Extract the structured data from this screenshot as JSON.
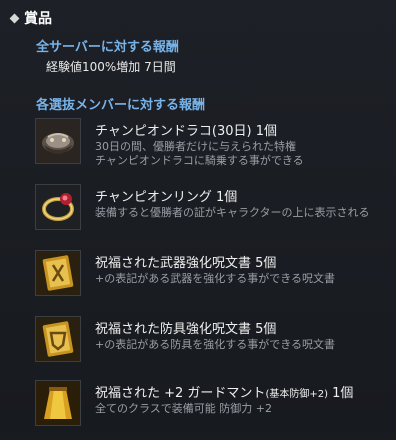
{
  "header": {
    "title": "賞品"
  },
  "all_servers": {
    "heading": "全サーバーに対する報酬",
    "reward": "経験値100%増加 7日間"
  },
  "selected_members": {
    "heading": "各選抜メンバーに対する報酬",
    "items": [
      {
        "name": "チャンピオンドラコ(30日)",
        "qty": "1個",
        "desc1": "30日の間、優勝者だけに与えられた特権",
        "desc2": "チャンピオンドラコに騎乗する事ができる",
        "icon": "dragon-saddle-icon"
      },
      {
        "name": "チャンピオンリング",
        "qty": "1個",
        "desc1": "装備すると優勝者の証がキャラクターの上に表示される",
        "desc2": "",
        "icon": "ring-icon"
      },
      {
        "name": "祝福された武器強化呪文書",
        "qty": "5個",
        "desc1": "+の表記がある武器を強化する事ができる呪文書",
        "desc2": "",
        "icon": "weapon-scroll-icon"
      },
      {
        "name": "祝福された防具強化呪文書",
        "qty": "5個",
        "desc1": "+の表記がある防具を強化する事ができる呪文書",
        "desc2": "",
        "icon": "armor-scroll-icon"
      },
      {
        "name": "祝福された +2 ガードマント",
        "name_note": "(基本防御+2)",
        "qty": "1個",
        "desc1": "全てのクラスで装備可能  防御力 +2",
        "desc2": "",
        "icon": "cloak-icon"
      }
    ]
  },
  "colors": {
    "heading_blue": "#78b3e8",
    "desc_gray": "#9a9ea5",
    "background": "#181b20"
  }
}
